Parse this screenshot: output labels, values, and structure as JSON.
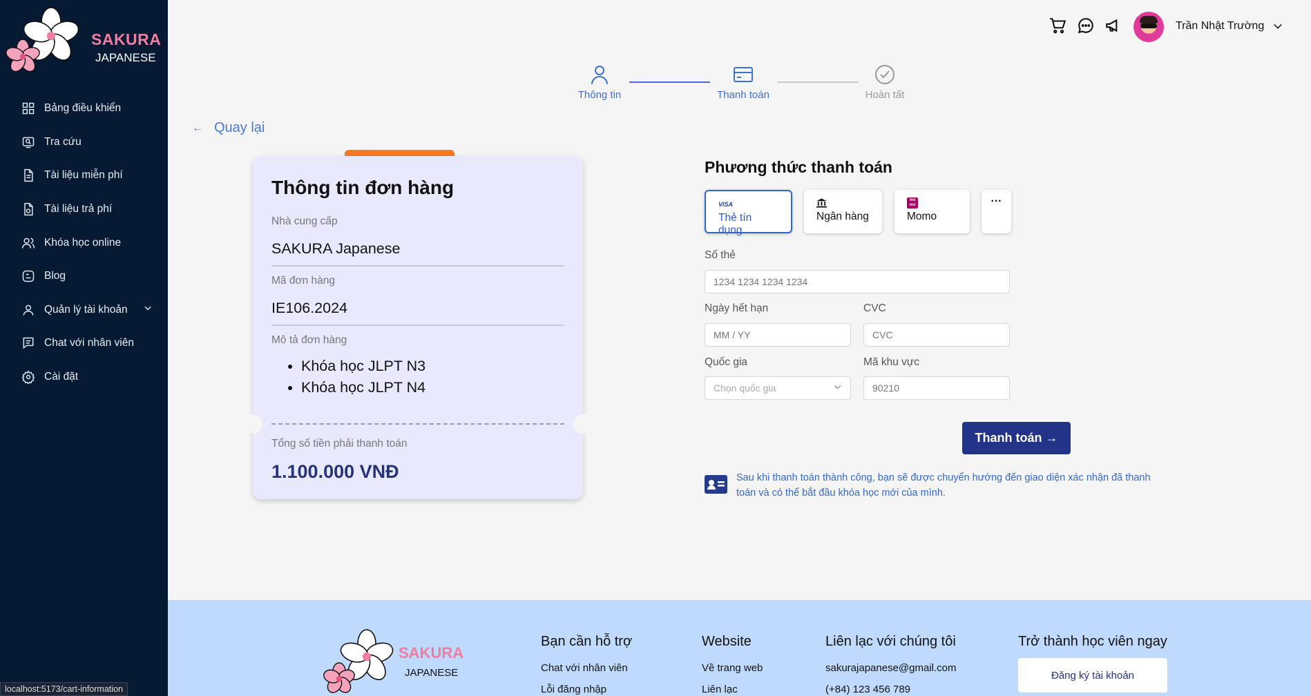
{
  "brand": {
    "name_line1": "SAKURA",
    "name_line2": "JAPANESE"
  },
  "sidebar": {
    "items": [
      {
        "label": "Bảng điều khiển",
        "icon": "dashboard-icon"
      },
      {
        "label": "Tra cứu",
        "icon": "search-icon"
      },
      {
        "label": "Tài liệu miễn phí",
        "icon": "document-icon"
      },
      {
        "label": "Tài liệu trả phí",
        "icon": "paid-document-icon"
      },
      {
        "label": "Khóa học online",
        "icon": "users-icon"
      },
      {
        "label": "Blog",
        "icon": "blog-icon"
      },
      {
        "label": "Quản lý tài khoản",
        "icon": "user-icon"
      },
      {
        "label": "Chat với nhân viên",
        "icon": "chat-icon"
      },
      {
        "label": "Cài đặt",
        "icon": "gear-icon"
      }
    ]
  },
  "status_bar": {
    "url": "localhost:5173/cart-information"
  },
  "header": {
    "user_name": "Trần Nhật Trường"
  },
  "stepper": {
    "steps": [
      {
        "label": "Thông tin",
        "state": "done"
      },
      {
        "label": "Thanh toán",
        "state": "active"
      },
      {
        "label": "Hoàn tất",
        "state": "pending"
      }
    ]
  },
  "back_label": "Quay lại",
  "order": {
    "title": "Thông tin đơn hàng",
    "provider_label": "Nhà cung cấp",
    "provider_value": "SAKURA Japanese",
    "code_label": "Mã đơn hàng",
    "code_value": "IE106.2024",
    "desc_label": "Mô tả đơn hàng",
    "items": [
      "Khóa học JLPT N3",
      "Khóa học JLPT N4"
    ],
    "total_label": "Tổng số tiền phải thanh toán",
    "total_value": "1.100.000 VNĐ"
  },
  "payment": {
    "title": "Phương thức thanh toán",
    "methods": [
      {
        "label": "Thẻ tín dụng",
        "badge": "VISA",
        "selected": true
      },
      {
        "label": "Ngân hàng",
        "selected": false
      },
      {
        "label": "Momo",
        "badge": "mo mo",
        "selected": false
      },
      {
        "label": "···",
        "selected": false
      }
    ],
    "card_number_label": "Số thẻ",
    "card_number_placeholder": "1234 1234 1234 1234",
    "expiry_label": "Ngày hết hạn",
    "expiry_placeholder": "MM / YY",
    "cvc_label": "CVC",
    "cvc_placeholder": "CVC",
    "country_label": "Quốc gia",
    "country_placeholder": "Chọn quốc gia",
    "zip_label": "Mã khu vực",
    "zip_placeholder": "90210",
    "submit_label": "Thanh toán →",
    "note": "Sau khi thanh toán thành công, bạn sẽ được chuyển hướng đến giao diện xác nhận đã thanh toán và có thể bắt đầu khóa học mới của mình."
  },
  "footer": {
    "support": {
      "heading": "Bạn cần hỗ trợ",
      "links": [
        "Chat với nhân viên",
        "Lỗi đăng nhập"
      ]
    },
    "website": {
      "heading": "Website",
      "links": [
        "Về trang web",
        "Liên lạc"
      ]
    },
    "contact": {
      "heading": "Liên lạc với chúng tôi",
      "email": "sakurajapanese@gmail.com",
      "phone": "(+84) 123 456 789"
    },
    "signup": {
      "heading": "Trở thành học viên ngay",
      "button": "Đăng ký tài khoản"
    }
  },
  "colors": {
    "sidebar_bg": "#061a33",
    "accent": "#233488",
    "brand_pink": "#f07ca0",
    "footer_bg": "#bfdafc",
    "link_blue": "#4a7ad6"
  }
}
